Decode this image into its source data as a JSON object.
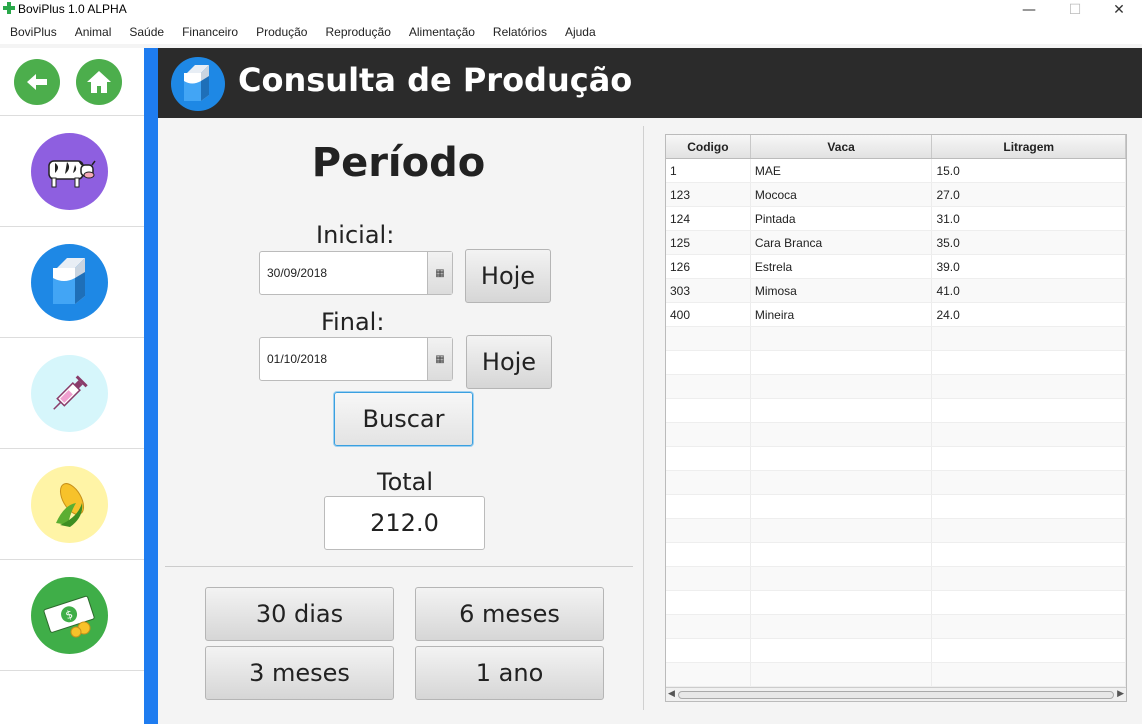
{
  "window": {
    "title": "BoviPlus 1.0 ALPHA",
    "minimize_glyph": "—",
    "maximize_glyph": "☐",
    "close_glyph": "✕"
  },
  "menu": [
    "BoviPlus",
    "Animal",
    "Saúde",
    "Financeiro",
    "Produção",
    "Reprodução",
    "Alimentação",
    "Relatórios",
    "Ajuda"
  ],
  "sidebar": {
    "nav_icons": [
      "back-arrow-icon",
      "home-icon"
    ],
    "items": [
      {
        "name": "cow-icon",
        "color": "#8e5fe0"
      },
      {
        "name": "milk-carton-icon",
        "color": "#1e88e5"
      },
      {
        "name": "syringe-icon",
        "color": "#d6f6fb"
      },
      {
        "name": "corn-icon",
        "color": "#fff4a6"
      },
      {
        "name": "money-icon",
        "color": "#3fae48"
      }
    ]
  },
  "header": {
    "title": "Consulta de Produção"
  },
  "form": {
    "periodo_label": "Período",
    "inicial_label": "Inicial:",
    "inicial_value": "30/09/2018",
    "final_label": "Final:",
    "final_value": "01/10/2018",
    "hoje_label": "Hoje",
    "buscar_label": "Buscar",
    "total_label": "Total",
    "total_value": "212.0",
    "calendar_glyph": "▦"
  },
  "quick_ranges": [
    "30 dias",
    "6 meses",
    "3 meses",
    "1 ano"
  ],
  "table": {
    "columns": [
      "Codigo",
      "Vaca",
      "Litragem"
    ],
    "rows": [
      [
        "1",
        "MAE",
        "15.0"
      ],
      [
        "123",
        "Mococa",
        "27.0"
      ],
      [
        "124",
        "Pintada",
        "31.0"
      ],
      [
        "125",
        "Cara Branca",
        "35.0"
      ],
      [
        "126",
        "Estrela",
        "39.0"
      ],
      [
        "303",
        "Mimosa",
        "41.0"
      ],
      [
        "400",
        "Mineira",
        "24.0"
      ]
    ]
  },
  "colors": {
    "accent_blue": "#1e7cf0",
    "header_bg": "#2b2b2b",
    "nav_green": "#4cae4c"
  }
}
